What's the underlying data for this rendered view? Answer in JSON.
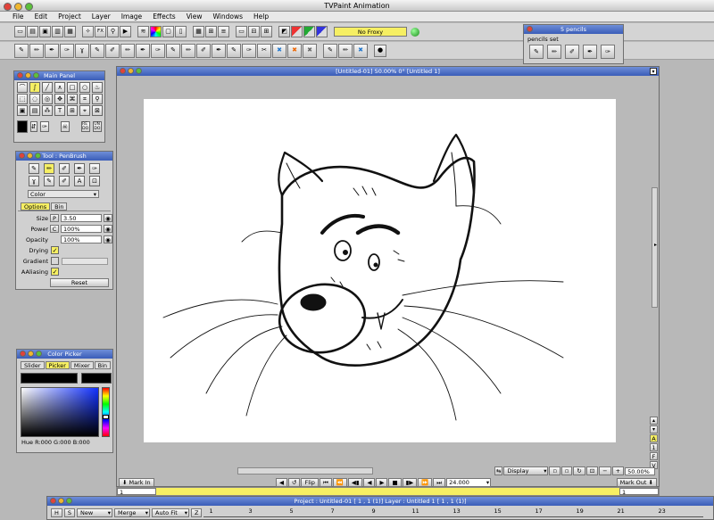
{
  "app": {
    "title": "TVPaint Animation"
  },
  "menu": [
    "File",
    "Edit",
    "Project",
    "Layer",
    "Image",
    "Effects",
    "View",
    "Windows",
    "Help"
  ],
  "toolbar": {
    "proxy_label": "No Froxy",
    "fx_label": "FX"
  },
  "pencils": {
    "title": "5 pencils",
    "set_label": "pencils set"
  },
  "main_panel": {
    "title": "Main Panel",
    "redo": "RE\nDO",
    "undo": "UN\nDO"
  },
  "tool_panel": {
    "title": "Tool : PenBrush",
    "mode": "Color",
    "tabs": [
      "Options",
      "Bin"
    ],
    "size_label": "Size",
    "size_flag": "P",
    "size_value": "3.50",
    "power_label": "Power",
    "power_flag": "C",
    "power_value": "100%",
    "opacity_label": "Opacity",
    "opacity_value": "100%",
    "drying_label": "Drying",
    "gradient_label": "Gradient",
    "aaliasing_label": "AAliasing",
    "reset_label": "Reset"
  },
  "color_picker": {
    "title": "Color Picker",
    "tabs": [
      "Slider",
      "Picker",
      "Mixer",
      "Bin"
    ],
    "readout": "Hue R:000 G:000 B:000"
  },
  "canvas_window": {
    "title": "[Untitled-01]  50.00%  0°  [Untitled 1]"
  },
  "bottom_bar": {
    "display_label": "Display",
    "zoom": "50.00%",
    "mark_in": "Mark In",
    "mark_out": "Mark Out",
    "flip": "Flip",
    "fps": "24.000",
    "frame_in": "1",
    "frame_out": "1",
    "side_letters": [
      "A",
      "1",
      "F",
      "V"
    ]
  },
  "timeline": {
    "title": "Project : Untitled-01 [ 1 , 1 (1)]      Layer : Untitled 1 [ 1 , 1 (1)]",
    "h": "H",
    "s": "S",
    "new": "New",
    "merge": "Merge",
    "autofit": "Auto Fit",
    "z": "Z",
    "ticks": [
      "1",
      "3",
      "5",
      "7",
      "9",
      "11",
      "13",
      "15",
      "17",
      "19",
      "21",
      "23"
    ]
  },
  "colors": {
    "accent_yellow": "#f6ef63",
    "title_blue": "#3a5db8",
    "canvas_bg": "#ffffff"
  }
}
